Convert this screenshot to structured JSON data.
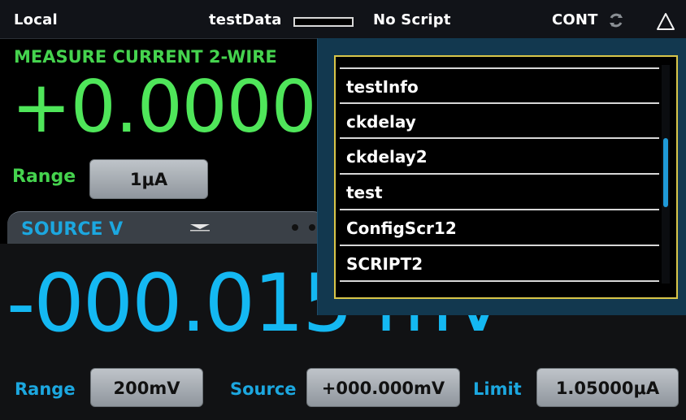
{
  "status": {
    "mode": "Local",
    "buffer_name": "testData",
    "script_state": "No Script",
    "trigger_mode": "CONT",
    "icons": {
      "sync": "sync-icon",
      "alert": "bell-icon"
    }
  },
  "measure": {
    "function_label": "MEASURE CURRENT 2-WIRE",
    "reading": "+0.0000",
    "range_label": "Range",
    "range_value": "1μA"
  },
  "source": {
    "tab_title": "SOURCE V",
    "reading": "-000.015 mV",
    "range_label": "Range",
    "range_value": "200mV",
    "source_label": "Source",
    "source_value": "+000.000mV",
    "limit_label": "Limit",
    "limit_value": "1.05000μA"
  },
  "dropdown": {
    "items": [
      "testInfo",
      "ckdelay",
      "ckdelay2",
      "test",
      "ConfigScr12",
      "SCRIPT2"
    ]
  },
  "colors": {
    "measure_accent": "#45d34e",
    "source_accent": "#1ca7df",
    "dropdown_border": "#d9c64a",
    "dropdown_bg": "#12384f"
  }
}
